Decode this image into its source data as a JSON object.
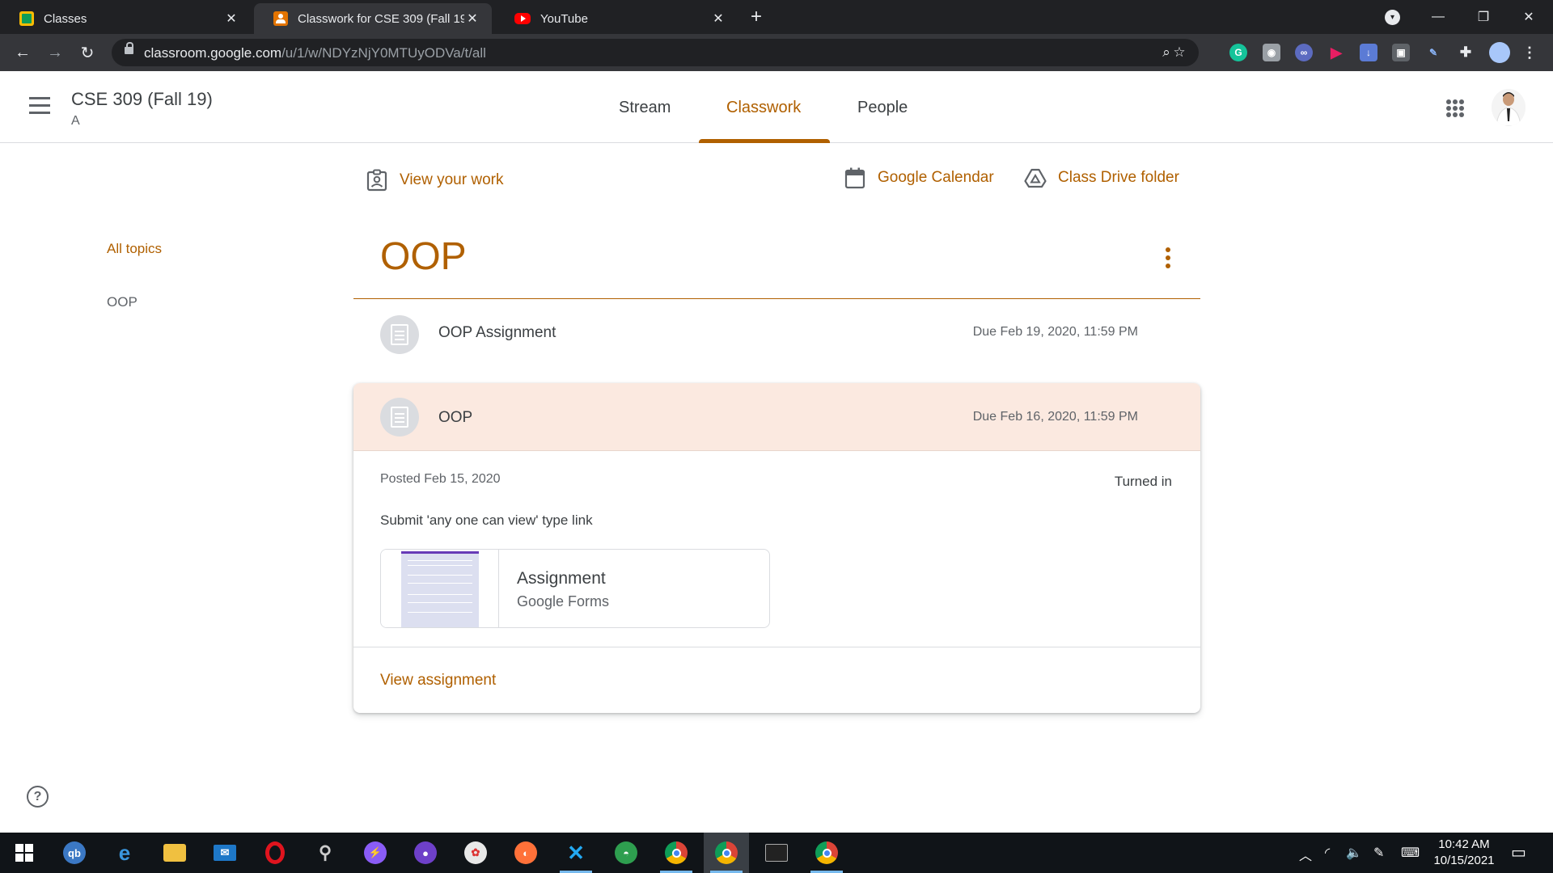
{
  "browser": {
    "tabs": [
      {
        "title": "Classes",
        "favicon_color": "#fbbc04",
        "active": false
      },
      {
        "title": "Classwork for CSE 309 (Fall 19) A",
        "favicon_color": "#e37400",
        "active": true
      },
      {
        "title": "YouTube",
        "favicon_color": "#ff0000",
        "active": false
      }
    ],
    "url_host": "classroom.google.com",
    "url_path": "/u/1/w/NDYzNjY0MTUyODVa/t/all"
  },
  "header": {
    "class_name": "CSE 309 (Fall 19)",
    "section": "A",
    "nav": [
      {
        "label": "Stream",
        "active": false
      },
      {
        "label": "Classwork",
        "active": true
      },
      {
        "label": "People",
        "active": false
      }
    ]
  },
  "toplinks": {
    "view_work": "View your work",
    "calendar": "Google Calendar",
    "drive": "Class Drive folder"
  },
  "sidebar": {
    "items": [
      {
        "label": "All topics",
        "active": true
      },
      {
        "label": "OOP",
        "active": false
      }
    ]
  },
  "topic": {
    "title": "OOP",
    "items": [
      {
        "title": "OOP Assignment",
        "due": "Due Feb 19, 2020, 11:59 PM"
      },
      {
        "title": "OOP",
        "due": "Due Feb 16, 2020, 11:59 PM",
        "expanded": true
      }
    ]
  },
  "expanded": {
    "posted": "Posted Feb 15, 2020",
    "status": "Turned in",
    "description": "Submit 'any one can view' type link",
    "attachment_title": "Assignment",
    "attachment_type": "Google Forms",
    "view_link": "View assignment"
  },
  "colors": {
    "accent": "#b06000",
    "expanded_bg": "#fbe9e0"
  },
  "taskbar": {
    "clock_time": "10:42 AM",
    "clock_date": "10/15/2021"
  }
}
